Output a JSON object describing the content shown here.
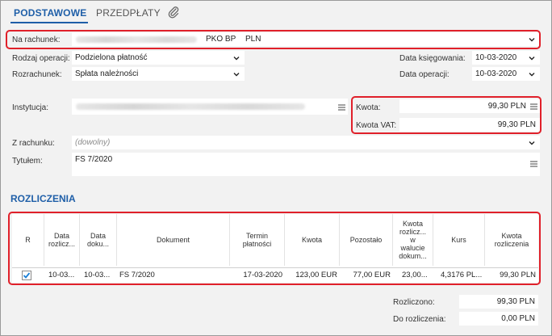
{
  "tabs": {
    "main": "PODSTAWOWE",
    "second": "PRZEDPŁATY",
    "attach_icon": "paperclip-icon"
  },
  "form": {
    "na_rachunek_label": "Na rachunek:",
    "bank": "PKO BP",
    "currency": "PLN",
    "rodzaj_label": "Rodzaj operacji:",
    "rodzaj_value": "Podzielona płatność",
    "rozrachunek_label": "Rozrachunek:",
    "rozrachunek_value": "Spłata należności",
    "data_ksiegowania_label": "Data księgowania:",
    "data_ksiegowania_value": "10-03-2020",
    "data_operacji_label": "Data operacji:",
    "data_operacji_value": "10-03-2020",
    "instytucja_label": "Instytucja:",
    "kwota_label": "Kwota:",
    "kwota_value": "99,30 PLN",
    "kwota_vat_label": "Kwota VAT:",
    "kwota_vat_value": "99,30 PLN",
    "z_rachunku_label": "Z rachunku:",
    "z_rachunku_placeholder": "(dowolny)",
    "tytulem_label": "Tytułem:",
    "tytulem_value": "FS 7/2020"
  },
  "rozliczenia": {
    "title": "ROZLICZENIA",
    "headers": {
      "r": "R",
      "data_rozl": [
        "Data",
        "rozlicz..."
      ],
      "data_dok": [
        "Data",
        "doku..."
      ],
      "dokument": "Dokument",
      "termin": [
        "Termin",
        "płatności"
      ],
      "kwota": "Kwota",
      "pozostalo": "Pozostało",
      "kwota_waluta": [
        "Kwota",
        "rozlicz...",
        "w",
        "walucie",
        "dokum..."
      ],
      "kurs": "Kurs",
      "kwota_rozl": [
        "Kwota",
        "rozliczenia"
      ]
    },
    "row": {
      "checked": true,
      "data_rozl": "10-03...",
      "data_dok": "10-03...",
      "dokument": "FS 7/2020",
      "termin": "17-03-2020",
      "kwota": "123,00 EUR",
      "pozostalo": "77,00 EUR",
      "kwota_waluta": "23,00...",
      "kurs": "4,3176 PL...",
      "kwota_rozl": "99,30 PLN"
    }
  },
  "summary": {
    "rozliczono_label": "Rozliczono:",
    "rozliczono_value": "99,30 PLN",
    "do_rozliczenia_label": "Do rozliczenia:",
    "do_rozliczenia_value": "0,00 PLN"
  },
  "colors": {
    "accent": "#1f5fa8",
    "highlight": "#e0202a",
    "check": "#1a7fd6"
  }
}
